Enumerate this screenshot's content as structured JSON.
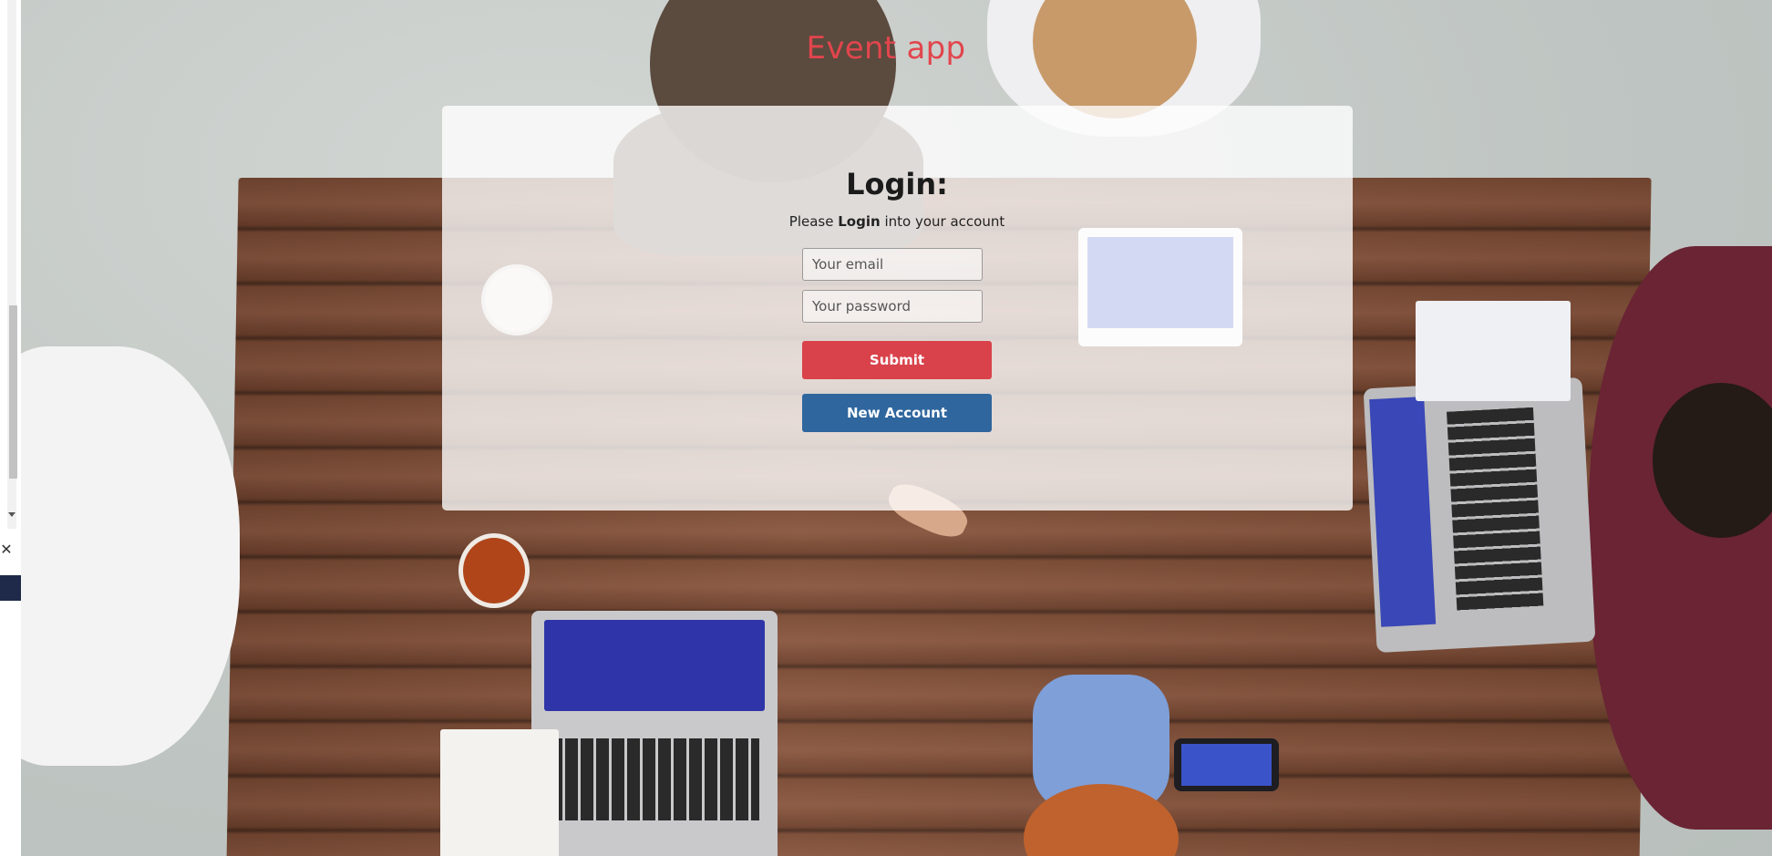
{
  "app": {
    "title": "Event app"
  },
  "login": {
    "heading": "Login:",
    "subtitle_prefix": "Please",
    "subtitle_bold": "Login",
    "subtitle_suffix": "into your account",
    "email_placeholder": "Your email",
    "email_value": "",
    "password_placeholder": "Your password",
    "password_value": "",
    "submit_label": "Submit",
    "new_account_label": "New Account"
  },
  "sidebar": {
    "close_symbol": "✕"
  },
  "colors": {
    "title": "#e2454d",
    "submit": "#d9424a",
    "new_account": "#2f669e",
    "card_overlay": "rgba(255,255,255,0.78)"
  },
  "icons": {
    "close": "close-icon",
    "scroll_down": "chevron-down-icon"
  }
}
